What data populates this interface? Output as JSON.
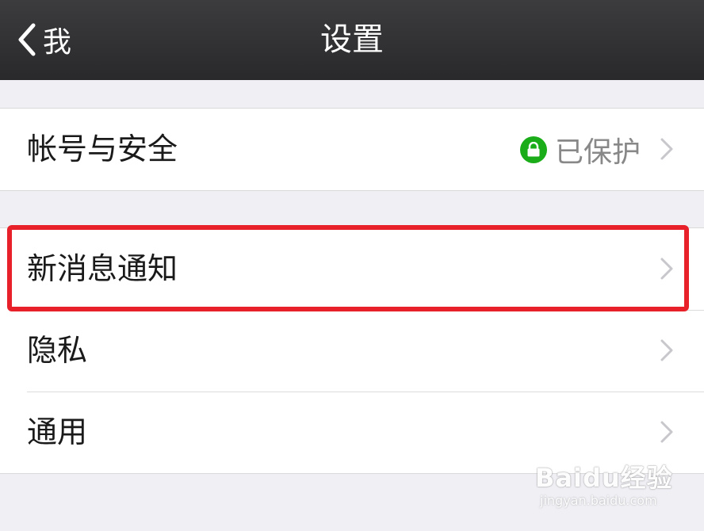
{
  "navbar": {
    "back_label": "我",
    "title": "设置"
  },
  "groups": [
    {
      "items": [
        {
          "label": "帐号与安全",
          "detail": "已保护",
          "detail_icon": "lock-icon"
        }
      ]
    },
    {
      "items": [
        {
          "label": "新消息通知",
          "highlighted": true
        },
        {
          "label": "隐私"
        },
        {
          "label": "通用"
        }
      ]
    }
  ],
  "watermark": {
    "logo": "Baidu经验",
    "url": "jingyan.baidu.com"
  },
  "colors": {
    "navbar": "#2f2f31",
    "background": "#efeff4",
    "highlight_border": "#e8202a",
    "protected_badge": "#1aad19"
  }
}
